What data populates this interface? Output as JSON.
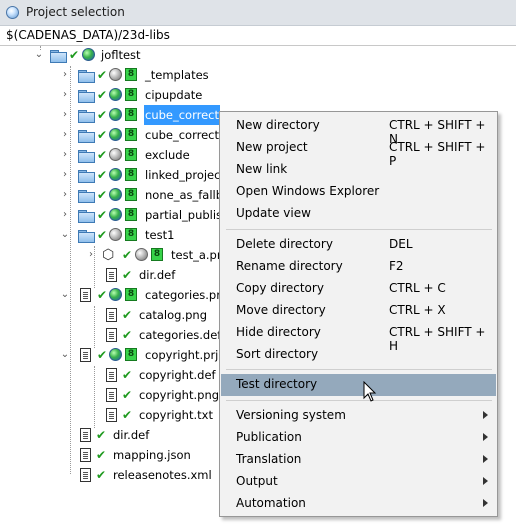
{
  "window": {
    "title": "Project selection",
    "icon": "globe-app-icon"
  },
  "path": "$(CADENAS_DATA)/23d-libs",
  "tree": {
    "root": "jofltest",
    "nodes": [
      "_templates",
      "cipupdate",
      "cube_correct",
      "cube_correct",
      "exclude",
      "linked_project",
      "none_as_fallba",
      "partial_publish",
      "test1",
      "test_a.prj",
      "dir.def",
      "categories.prj",
      "catalog.png",
      "categories.def",
      "copyright.prj",
      "copyright.def",
      "copyright.png",
      "copyright.txt",
      "dir.def",
      "mapping.json",
      "releasenotes.xml"
    ]
  },
  "context_menu": {
    "items": [
      {
        "label": "New directory",
        "shortcut": "CTRL + SHIFT + N"
      },
      {
        "label": "New project",
        "shortcut": "CTRL + SHIFT + P"
      },
      {
        "label": "New link",
        "shortcut": ""
      },
      {
        "label": "Open Windows Explorer",
        "shortcut": ""
      },
      {
        "label": "Update view",
        "shortcut": ""
      },
      {
        "label": "Delete directory",
        "shortcut": "DEL"
      },
      {
        "label": "Rename directory",
        "shortcut": "F2"
      },
      {
        "label": "Copy directory",
        "shortcut": "CTRL + C"
      },
      {
        "label": "Move directory",
        "shortcut": "CTRL + X"
      },
      {
        "label": "Hide directory",
        "shortcut": "CTRL + SHIFT + H"
      },
      {
        "label": "Sort directory",
        "shortcut": ""
      },
      {
        "label": "Test directory",
        "shortcut": ""
      },
      {
        "label": "Versioning system",
        "shortcut": ""
      },
      {
        "label": "Publication",
        "shortcut": ""
      },
      {
        "label": "Translation",
        "shortcut": ""
      },
      {
        "label": "Output",
        "shortcut": ""
      },
      {
        "label": "Automation",
        "shortcut": ""
      }
    ],
    "highlighted": "Test directory"
  },
  "colors": {
    "selection": "#3399ff",
    "menu_highlight": "#94a9bc",
    "menu_bg": "#f2f2f2"
  }
}
